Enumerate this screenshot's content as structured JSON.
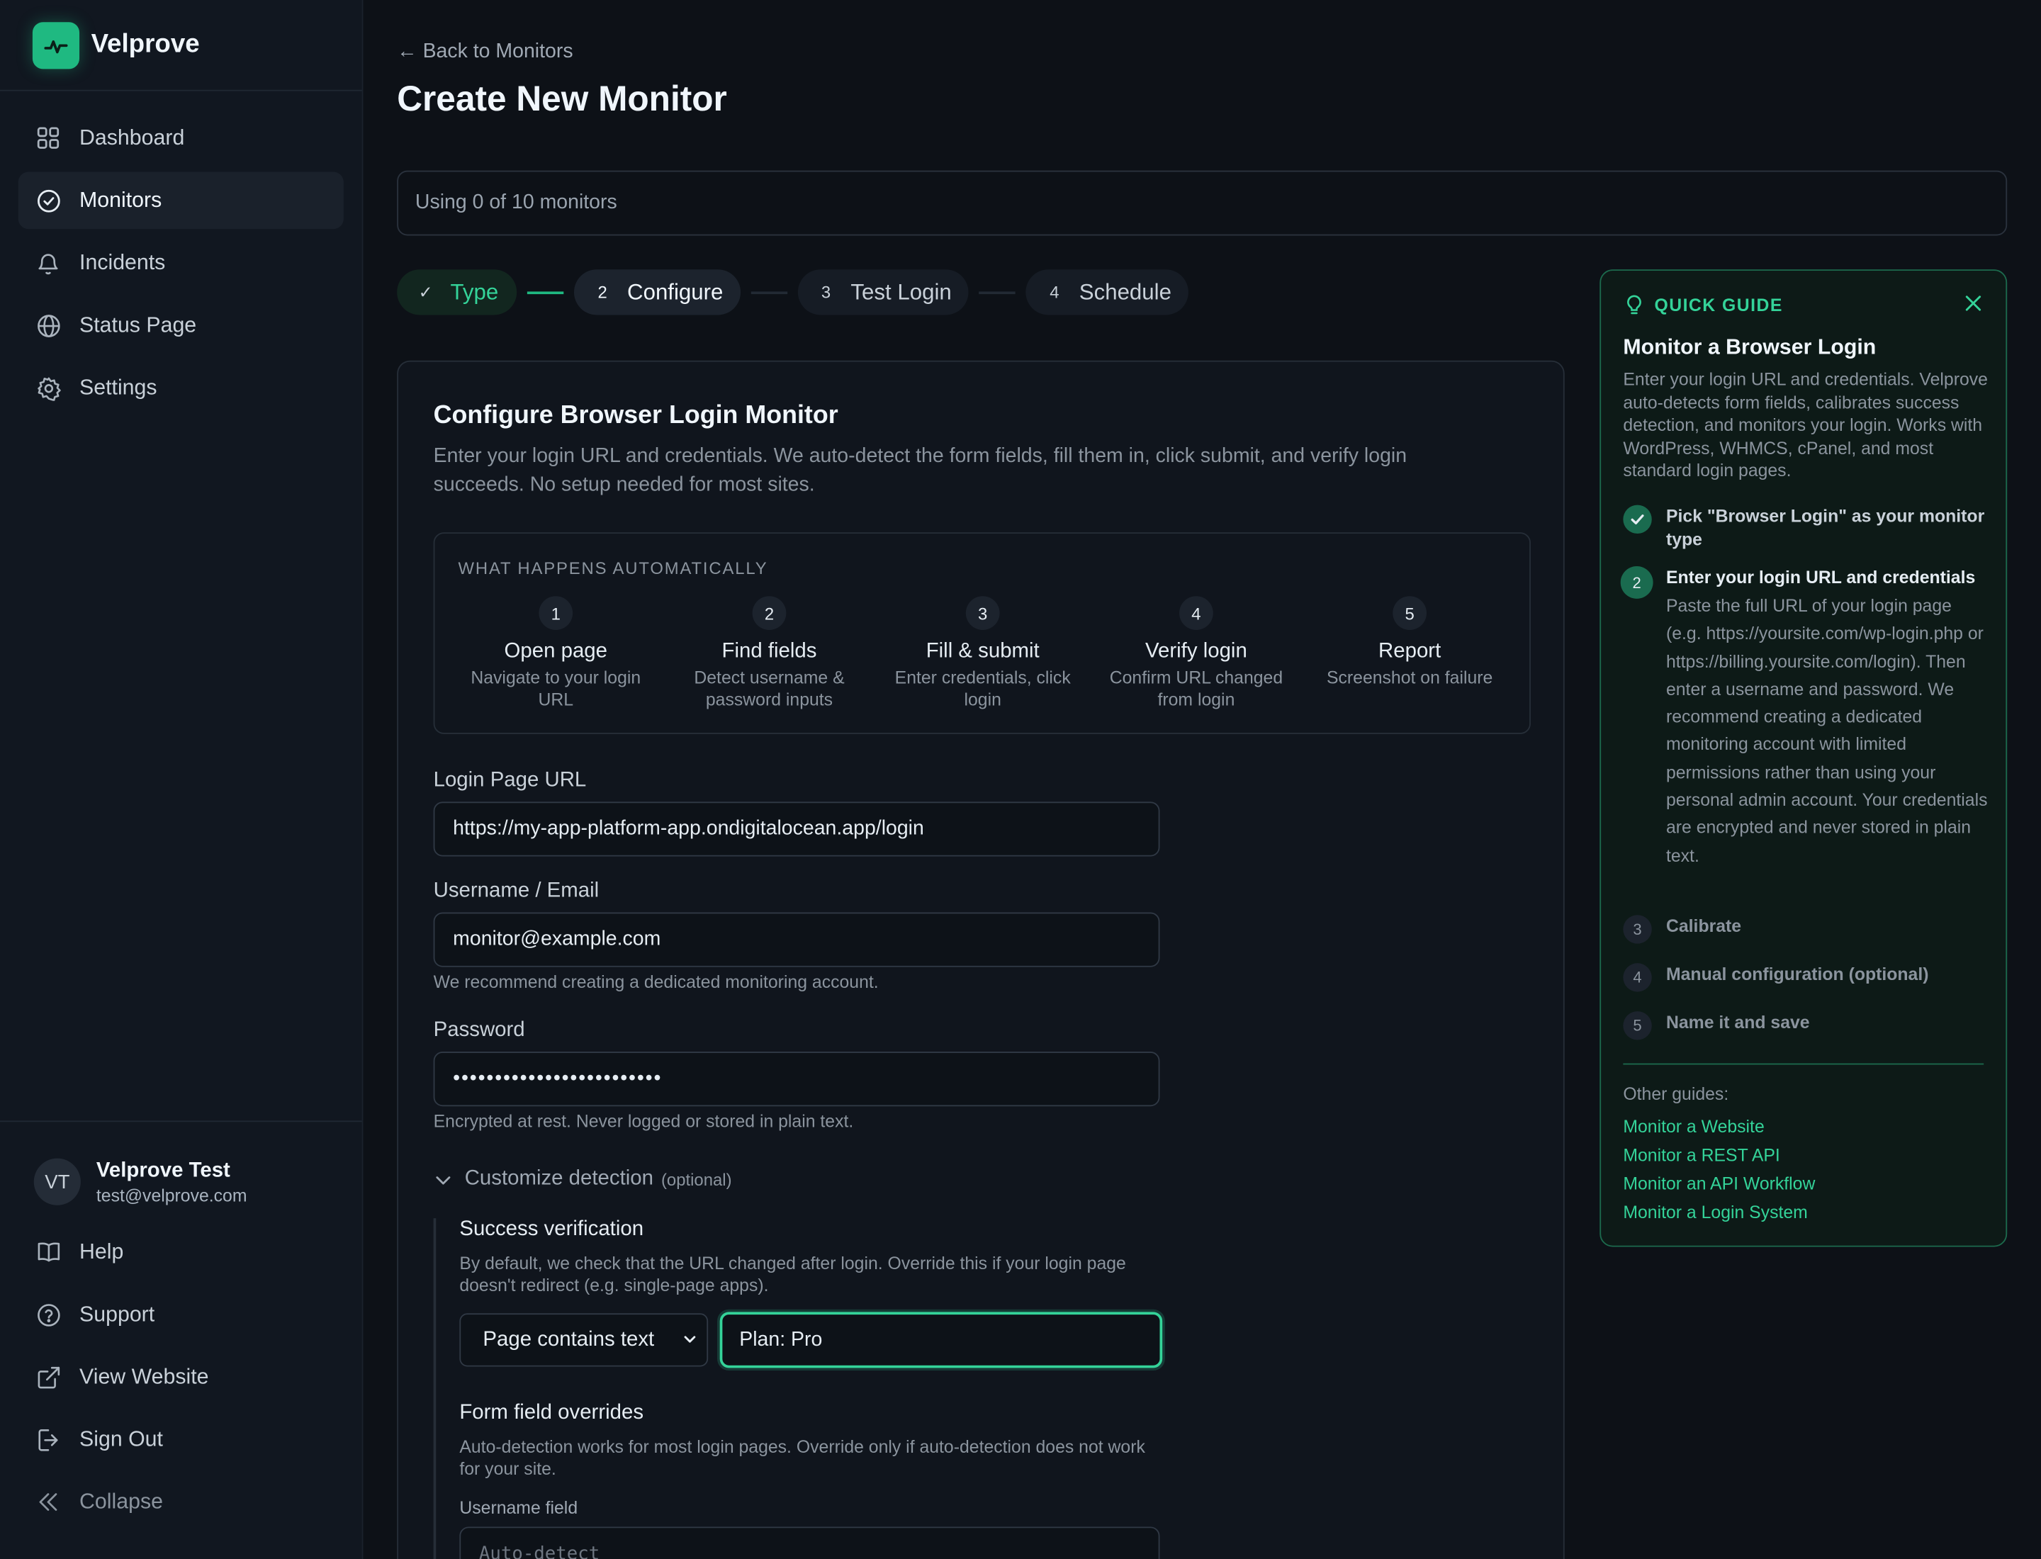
{
  "brand": {
    "name": "Velprove"
  },
  "sidebar": {
    "items": [
      {
        "label": "Dashboard",
        "icon": "grid-icon"
      },
      {
        "label": "Monitors",
        "icon": "check-circle-icon",
        "active": true
      },
      {
        "label": "Incidents",
        "icon": "bell-icon"
      },
      {
        "label": "Status Page",
        "icon": "globe-icon"
      },
      {
        "label": "Settings",
        "icon": "gear-icon"
      }
    ],
    "user": {
      "initials": "VT",
      "name": "Velprove Test",
      "email": "test@velprove.com"
    },
    "bottom": [
      {
        "label": "Help",
        "icon": "book-icon"
      },
      {
        "label": "Support",
        "icon": "question-circle-icon"
      },
      {
        "label": "View Website",
        "icon": "external-link-icon"
      },
      {
        "label": "Sign Out",
        "icon": "sign-out-icon"
      },
      {
        "label": "Collapse",
        "icon": "double-chevron-left-icon"
      }
    ]
  },
  "header": {
    "back_label": "← Back to Monitors",
    "title": "Create New Monitor",
    "usage": "Using 0 of 10 monitors"
  },
  "stepper": [
    {
      "num": "✓",
      "label": "Type",
      "state": "done"
    },
    {
      "num": "2",
      "label": "Configure",
      "state": "current"
    },
    {
      "num": "3",
      "label": "Test Login",
      "state": "pending"
    },
    {
      "num": "4",
      "label": "Schedule",
      "state": "pending"
    }
  ],
  "form": {
    "title": "Configure Browser Login Monitor",
    "description": "Enter your login URL and credentials. We auto-detect the form fields, fill them in, click submit, and verify login succeeds. No setup needed for most sites.",
    "auto_heading": "WHAT HAPPENS AUTOMATICALLY",
    "auto_steps": [
      {
        "num": "1",
        "title": "Open page",
        "desc": "Navigate to your login URL"
      },
      {
        "num": "2",
        "title": "Find fields",
        "desc": "Detect username & password inputs"
      },
      {
        "num": "3",
        "title": "Fill & submit",
        "desc": "Enter credentials, click login"
      },
      {
        "num": "4",
        "title": "Verify login",
        "desc": "Confirm URL changed from login"
      },
      {
        "num": "5",
        "title": "Report",
        "desc": "Screenshot on failure"
      }
    ],
    "url_label": "Login Page URL",
    "url_value": "https://my-app-platform-app.ondigitalocean.app/login",
    "username_label": "Username / Email",
    "username_value": "monitor@example.com",
    "username_hint": "We recommend creating a dedicated monitoring account.",
    "password_label": "Password",
    "password_value": "•••••••••••••••••••••••••",
    "password_hint": "Encrypted at rest. Never logged or stored in plain text.",
    "customize_label": "Customize detection",
    "customize_optional": "(optional)",
    "success_title": "Success verification",
    "success_desc": "By default, we check that the URL changed after login. Override this if your login page doesn't redirect (e.g. single-page apps).",
    "success_select": "Page contains text",
    "success_text": "Plan: Pro",
    "overrides_title": "Form field overrides",
    "overrides_desc": "Auto-detection works for most login pages. Override only if auto-detection does not work for your site.",
    "username_field_label": "Username field",
    "username_field_placeholder": "Auto-detect"
  },
  "guide": {
    "heading": "QUICK GUIDE",
    "title": "Monitor a Browser Login",
    "description": "Enter your login URL and credentials. Velprove auto-detects form fields, calibrates success detection, and monitors your login. Works with WordPress, WHMCS, cPanel, and most standard login pages.",
    "steps": [
      {
        "num": "✓",
        "text": "Pick \"Browser Login\" as your monitor type",
        "state": "done"
      },
      {
        "num": "2",
        "text": "Enter your login URL and credentials",
        "state": "current"
      },
      {
        "num": "3",
        "text": "Calibrate",
        "state": "pending"
      },
      {
        "num": "4",
        "text": "Manual configuration (optional)",
        "state": "pending"
      },
      {
        "num": "5",
        "text": "Name it and save",
        "state": "pending"
      }
    ],
    "detail": "Paste the full URL of your login page (e.g. https://yoursite.com/wp-login.php or https://billing.yoursite.com/login). Then enter a username and password. We recommend creating a dedicated monitoring account with limited permissions rather than using your personal admin account. Your credentials are encrypted and never stored in plain text.",
    "other_label": "Other guides:",
    "links": [
      "Monitor a Website",
      "Monitor a REST API",
      "Monitor an API Workflow",
      "Monitor a Login System"
    ]
  },
  "colors": {
    "accent": "#34d399",
    "brand": "#1fb981",
    "background": "#0d1117"
  }
}
